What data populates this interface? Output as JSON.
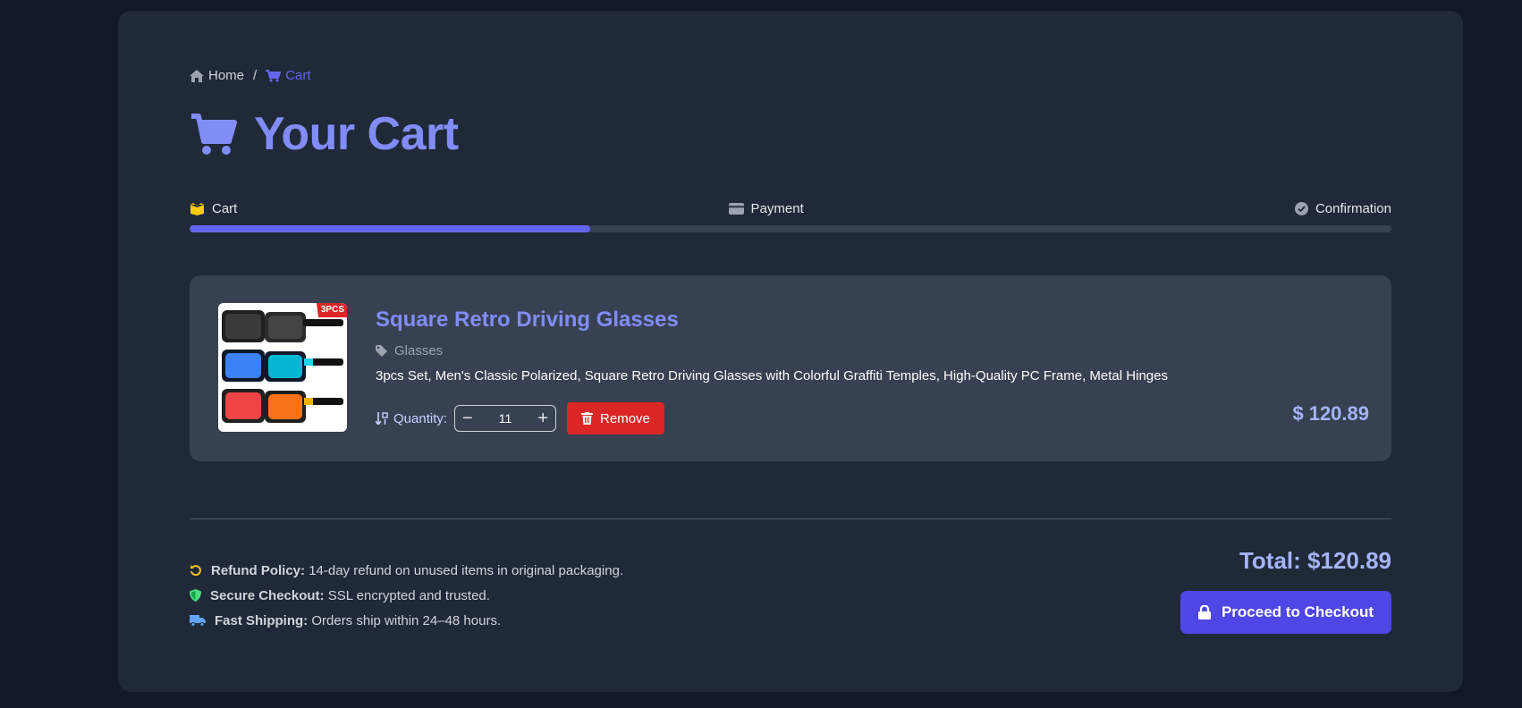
{
  "breadcrumb": {
    "home": "Home",
    "separator": "/",
    "current": "Cart"
  },
  "page": {
    "title": "Your Cart"
  },
  "steps": [
    {
      "label": "Cart",
      "icon": "box-open-icon"
    },
    {
      "label": "Payment",
      "icon": "credit-card-icon"
    },
    {
      "label": "Confirmation",
      "icon": "check-circle-icon"
    }
  ],
  "progress": {
    "value_fraction": 0.333
  },
  "item": {
    "title": "Square Retro Driving Glasses",
    "category": "Glasses",
    "description": "3pcs Set, Men's Classic Polarized, Square Retro Driving Glasses with Colorful Graffiti Temples, High-Quality PC Frame, Metal Hinges",
    "quantity_label": "Quantity:",
    "quantity": "11",
    "remove_label": "Remove",
    "currency_symbol": "$",
    "price": "120.89",
    "thumbnail_badge": "3PCS"
  },
  "policies": [
    {
      "title": "Refund Policy:",
      "text": "14-day refund on unused items in original packaging.",
      "icon": "undo-icon",
      "color": "#fbbf24"
    },
    {
      "title": "Secure Checkout:",
      "text": "SSL encrypted and trusted.",
      "icon": "shield-icon",
      "color": "#4ade80"
    },
    {
      "title": "Fast Shipping:",
      "text": "Orders ship within 24–48 hours.",
      "icon": "truck-icon",
      "color": "#60a5fa"
    }
  ],
  "summary": {
    "total_label": "Total: $120.89",
    "checkout_label": "Proceed to Checkout"
  },
  "colors": {
    "accent": "#6366f1",
    "danger": "#dc2626",
    "primary_button": "#4f46e5"
  }
}
